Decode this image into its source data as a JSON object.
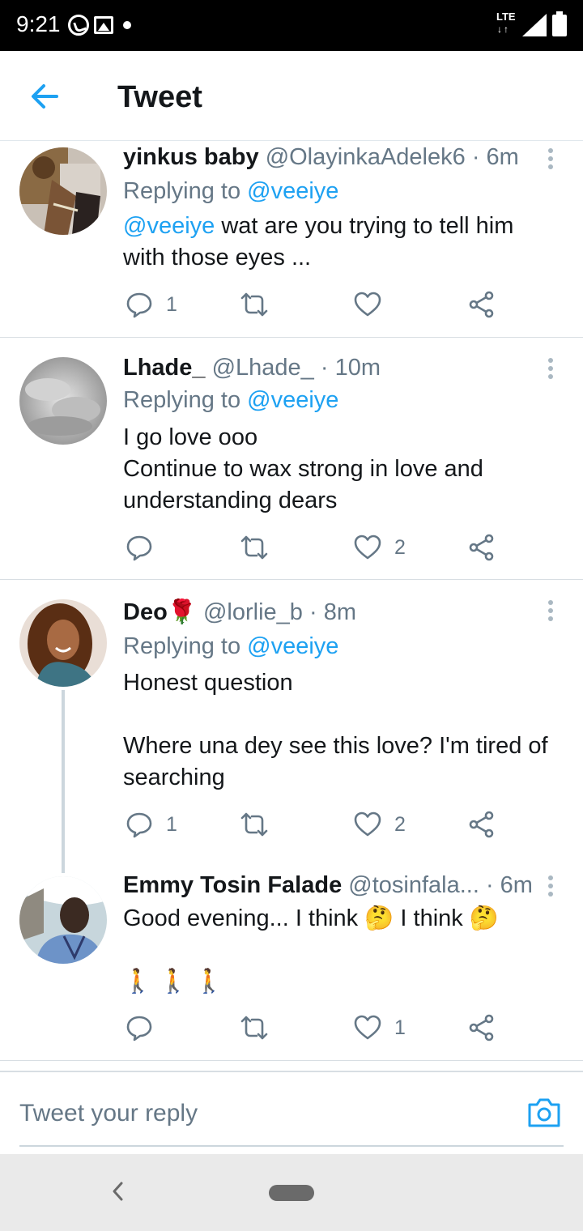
{
  "status_bar": {
    "time": "9:21",
    "network": "LTE",
    "arrows": "↓↑"
  },
  "header": {
    "title": "Tweet"
  },
  "tweets": [
    {
      "name": "yinkus baby",
      "handle": "@OlayinkaAdelek6",
      "time": "· 6m",
      "replying_prefix": "Replying to ",
      "replying_to": "@veeiye",
      "mention": "@veeiye",
      "lines": [
        " wat are you trying to tell him",
        "with those eyes ..."
      ],
      "reply_count": "1",
      "like_count": ""
    },
    {
      "name": "Lhade_",
      "handle": "@Lhade_",
      "time": "· 10m",
      "replying_prefix": "Replying to ",
      "replying_to": "@veeiye",
      "lines": [
        "I go love ooo",
        "Continue to wax strong in love and",
        "understanding dears"
      ],
      "reply_count": "",
      "like_count": "2"
    },
    {
      "name": "Deo",
      "name_emoji": "🌹",
      "handle": "@lorlie_b",
      "time": "· 8m",
      "replying_prefix": "Replying to ",
      "replying_to": "@veeiye",
      "lines": [
        "Honest question",
        "",
        "Where una dey see this love? I'm tired of",
        "searching"
      ],
      "reply_count": "1",
      "like_count": "2"
    },
    {
      "name": "Emmy Tosin Falade",
      "handle": "@tosinfala...",
      "time": "· 6m",
      "lines": [
        "Good evening... I think 🤔 I think 🤔",
        "",
        "🚶 🚶 🚶"
      ],
      "reply_count": "",
      "like_count": "1"
    }
  ],
  "reply_bar": {
    "placeholder": "Tweet your reply"
  },
  "colors": {
    "accent": "#1da1f2",
    "secondary_text": "#657786",
    "icon": "#657786"
  }
}
